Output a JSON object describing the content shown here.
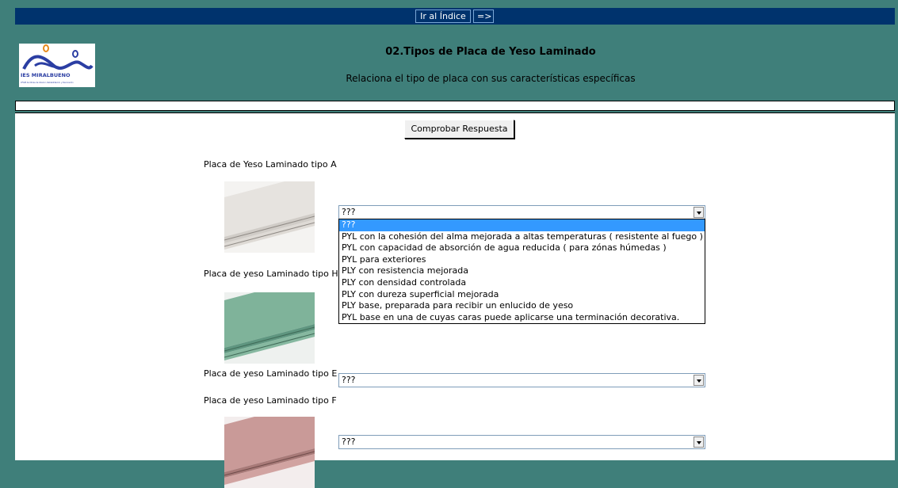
{
  "nav": {
    "index_label": "Ir al Índice",
    "next_label": "=>"
  },
  "header": {
    "logo_text": "IES MIRALBUENO",
    "logo_subtext": "CFGM de Obras de Interior, Rehabilitación y Decoración",
    "title": "02.Tipos de Placa de Yeso Laminado",
    "subtitle": "Relaciona el tipo de placa con sus características específicas"
  },
  "check_button": "Comprobar Respuesta",
  "questions": [
    {
      "label": "Placa de Yeso Laminado tipo A",
      "selected": "???",
      "board_color": "#e6e3df"
    },
    {
      "label": "Placa de yeso Laminado tipo H",
      "selected": "???",
      "board_color": "#7fb39a"
    },
    {
      "label": "Placa de yeso Laminado tipo E",
      "selected": "???"
    },
    {
      "label": "Placa de yeso Laminado tipo F",
      "selected": "???",
      "board_color": "#c99a98"
    }
  ],
  "dropdown_options": [
    "???",
    "PYL con la cohesión del alma mejorada a altas temperaturas ( resistente al fuego )",
    "PYL con capacidad de absorción de agua reducida ( para zónas húmedas )",
    "PYL para exteriores",
    "PLY con resistencia mejorada",
    "PLY con densidad controlada",
    "PLY con dureza superficial mejorada",
    "PLY base, preparada para recibir un enlucido de yeso",
    "PYL base en una de cuyas caras puede aplicarse una terminación decorativa."
  ],
  "colors": {
    "background": "#3f7f7a",
    "topbar": "#00336d",
    "highlight": "#3399ff"
  }
}
